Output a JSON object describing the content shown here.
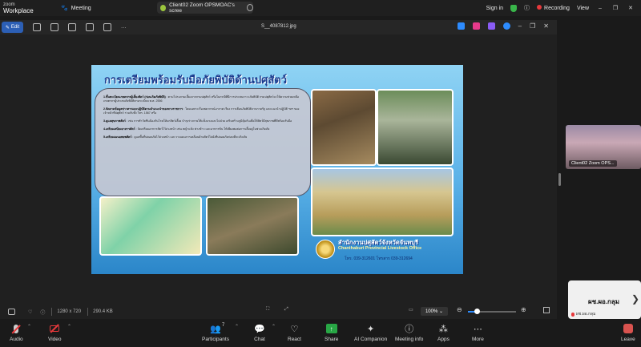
{
  "topbar": {
    "brand_line1": "zoom",
    "brand_line2": "Workplace",
    "meeting_label": "Meeting",
    "share_pill_label": "Client02 Zoom OPSMOAC's scree",
    "sign_in": "Sign in",
    "recording": "Recording",
    "view": "View",
    "win_min": "–",
    "win_max": "❐",
    "win_close": "✕"
  },
  "viewer": {
    "edit_label": "Edit",
    "filename": "S__4087812.jpg",
    "more_dots": "···",
    "footer": {
      "dimensions": "1280 x 720",
      "filesize": "290.4 KB",
      "zoom": "100%",
      "zoom_fraction": 0.18
    }
  },
  "slide": {
    "title": "การเตรียมพร้อมรับมือภัยพิบัติด้านปศุสัตว์",
    "items": [
      {
        "head": "1.ขึ้นทะเบียนเกษตรกรผู้เลี้ยงสัตว์ (ก่อนเกิดภัยพิบัติ)",
        "body": ": ตามโปรแกรมเลี้ยงจากกรมปศุสัตว์ หรือในกรณีที่มีการประสบภาวะภัยพิบัติ กรมปศุสัตว์จะให้ความช่วยเหลือเกษตรกรผู้ประสบภัยพิบัติตามระเบียบ พ.ศ. 2556"
      },
      {
        "head": "2.จัดตามข้อมูลข่าวสารและปฏิบัติตามคำแนะนำของทางราชการ",
        "body": ": โดยเฉพาะเรื่องพยากรณ์อากาศ เรียง การเตือนภัยพิบัติจากภาครัฐ และแนะนำปฏิบัติ ฯลฯ ของเจ้าหน้าที่ปศุสัตว์ ร่วมกับทั้ง โทร. 1567 หรือ"
      },
      {
        "head": "3.ดูแลสุขภาพสัตว์",
        "body": ": เช่น การทำวัคซีนป้องกันโรคให้แก่สัตว์เลี้ยง บำรุงร่างกายให้แข็งแรงและไม่ป่วย เสริมสร้างภูมิคุ้มกันเพื่อให้สัตว์มีสุขภาพที่ดีพร้อมรับมือ"
      },
      {
        "head": "4.เตรียมเสบียงอาหารสัตว์",
        "body": ": จัดเตรียมอาหารสัตว์ไว้ล่วงหน้า เช่น หญ้าแห้ง ฟางข้าว และอาหารข้น ให้เพียงพอต่อการเลี้ยงดูในช่วงเกิดภัย"
      },
      {
        "head": "5.เตรียมแผนอพยพสัตว์",
        "body": ": ดูแลพื้นที่ปลอดภัยไว้ล่วงหน้า และวางแผนการเคลื่อนย้ายสัตว์ไปยังที่ปลอดภัยก่อนที่จะเกิดภัย"
      }
    ],
    "office_th": "สำนักงานปศุสัตว์จังหวัดจันทบุรี",
    "office_en": "Chanthaburi Provincial Livestock Office",
    "office_tel": "โทร. 039-312601 โทรสาร 039-312694"
  },
  "tiles": {
    "participant1": "Client02 Zoom OPS...",
    "participant2_display": "ผช.ผอ.กลุม",
    "participant2_label": "ผช.ผอ.กลุม",
    "arrow": "❯"
  },
  "toolbar": {
    "audio": "Audio",
    "video": "Video",
    "participants": "Participants",
    "participants_count": "7",
    "chat": "Chat",
    "react": "React",
    "share": "Share",
    "ai_companion": "AI Companion",
    "meeting_info": "Meeting info",
    "apps": "Apps",
    "more": "More",
    "leave": "Leave"
  },
  "colors": {
    "accent": "#2d8cff",
    "record": "#e8393c",
    "share": "#28a745"
  }
}
